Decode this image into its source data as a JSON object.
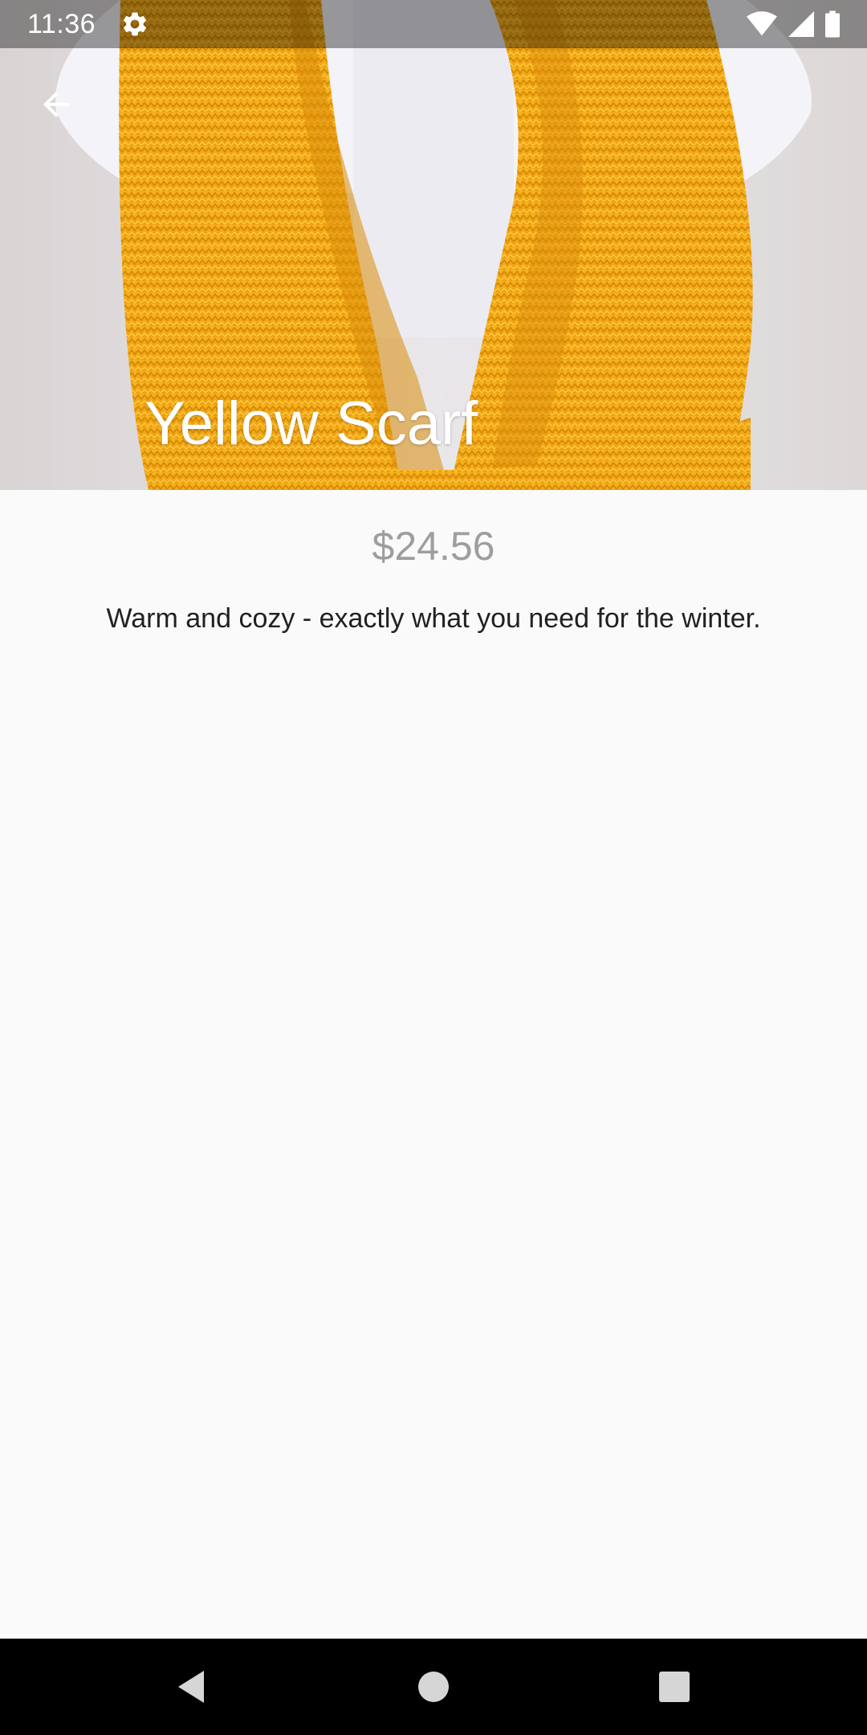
{
  "status_bar": {
    "time": "11:36",
    "icons": [
      "settings-gear-icon",
      "wifi-icon",
      "cell-signal-icon",
      "battery-icon"
    ]
  },
  "product": {
    "title": "Yellow Scarf",
    "price": "$24.56",
    "description": "Warm and cozy - exactly what you need for the winter."
  },
  "navigation": {
    "back_icon": "arrow-back-icon",
    "system_buttons": [
      "nav-back-icon",
      "nav-home-icon",
      "nav-recents-icon"
    ]
  },
  "colors": {
    "scarf_yellow": "#f5ae1a",
    "background": "#fafafa",
    "price_gray": "#9e9e9e",
    "text_dark": "#212121",
    "nav_bar": "#000000"
  }
}
